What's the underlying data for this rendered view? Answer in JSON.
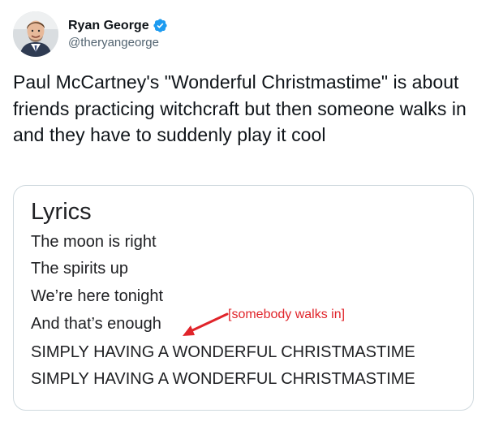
{
  "tweet": {
    "author": {
      "display_name": "Ryan George",
      "handle": "@theryangeorge",
      "verified_icon": "verified-badge-icon",
      "avatar_icon": "user-avatar"
    },
    "text": "Paul McCartney's \"Wonderful Christmastime\" is about friends practicing witchcraft but then someone walks in and they have to suddenly play it cool",
    "media": {
      "title": "Lyrics",
      "lines": [
        "The moon is right",
        "The spirits up",
        "We’re here tonight",
        "And that’s enough",
        "SIMPLY HAVING A WONDERFUL CHRISTMASTIME",
        "SIMPLY HAVING A WONDERFUL CHRISTMASTIME"
      ],
      "annotation": "[somebody walks in]",
      "annotation_color": "#e0242a",
      "arrow_icon": "red-arrow-icon"
    }
  },
  "colors": {
    "text_primary": "#0f1419",
    "text_secondary": "#536471",
    "verified_blue": "#1d9bf0",
    "card_border": "#cfd9de"
  }
}
